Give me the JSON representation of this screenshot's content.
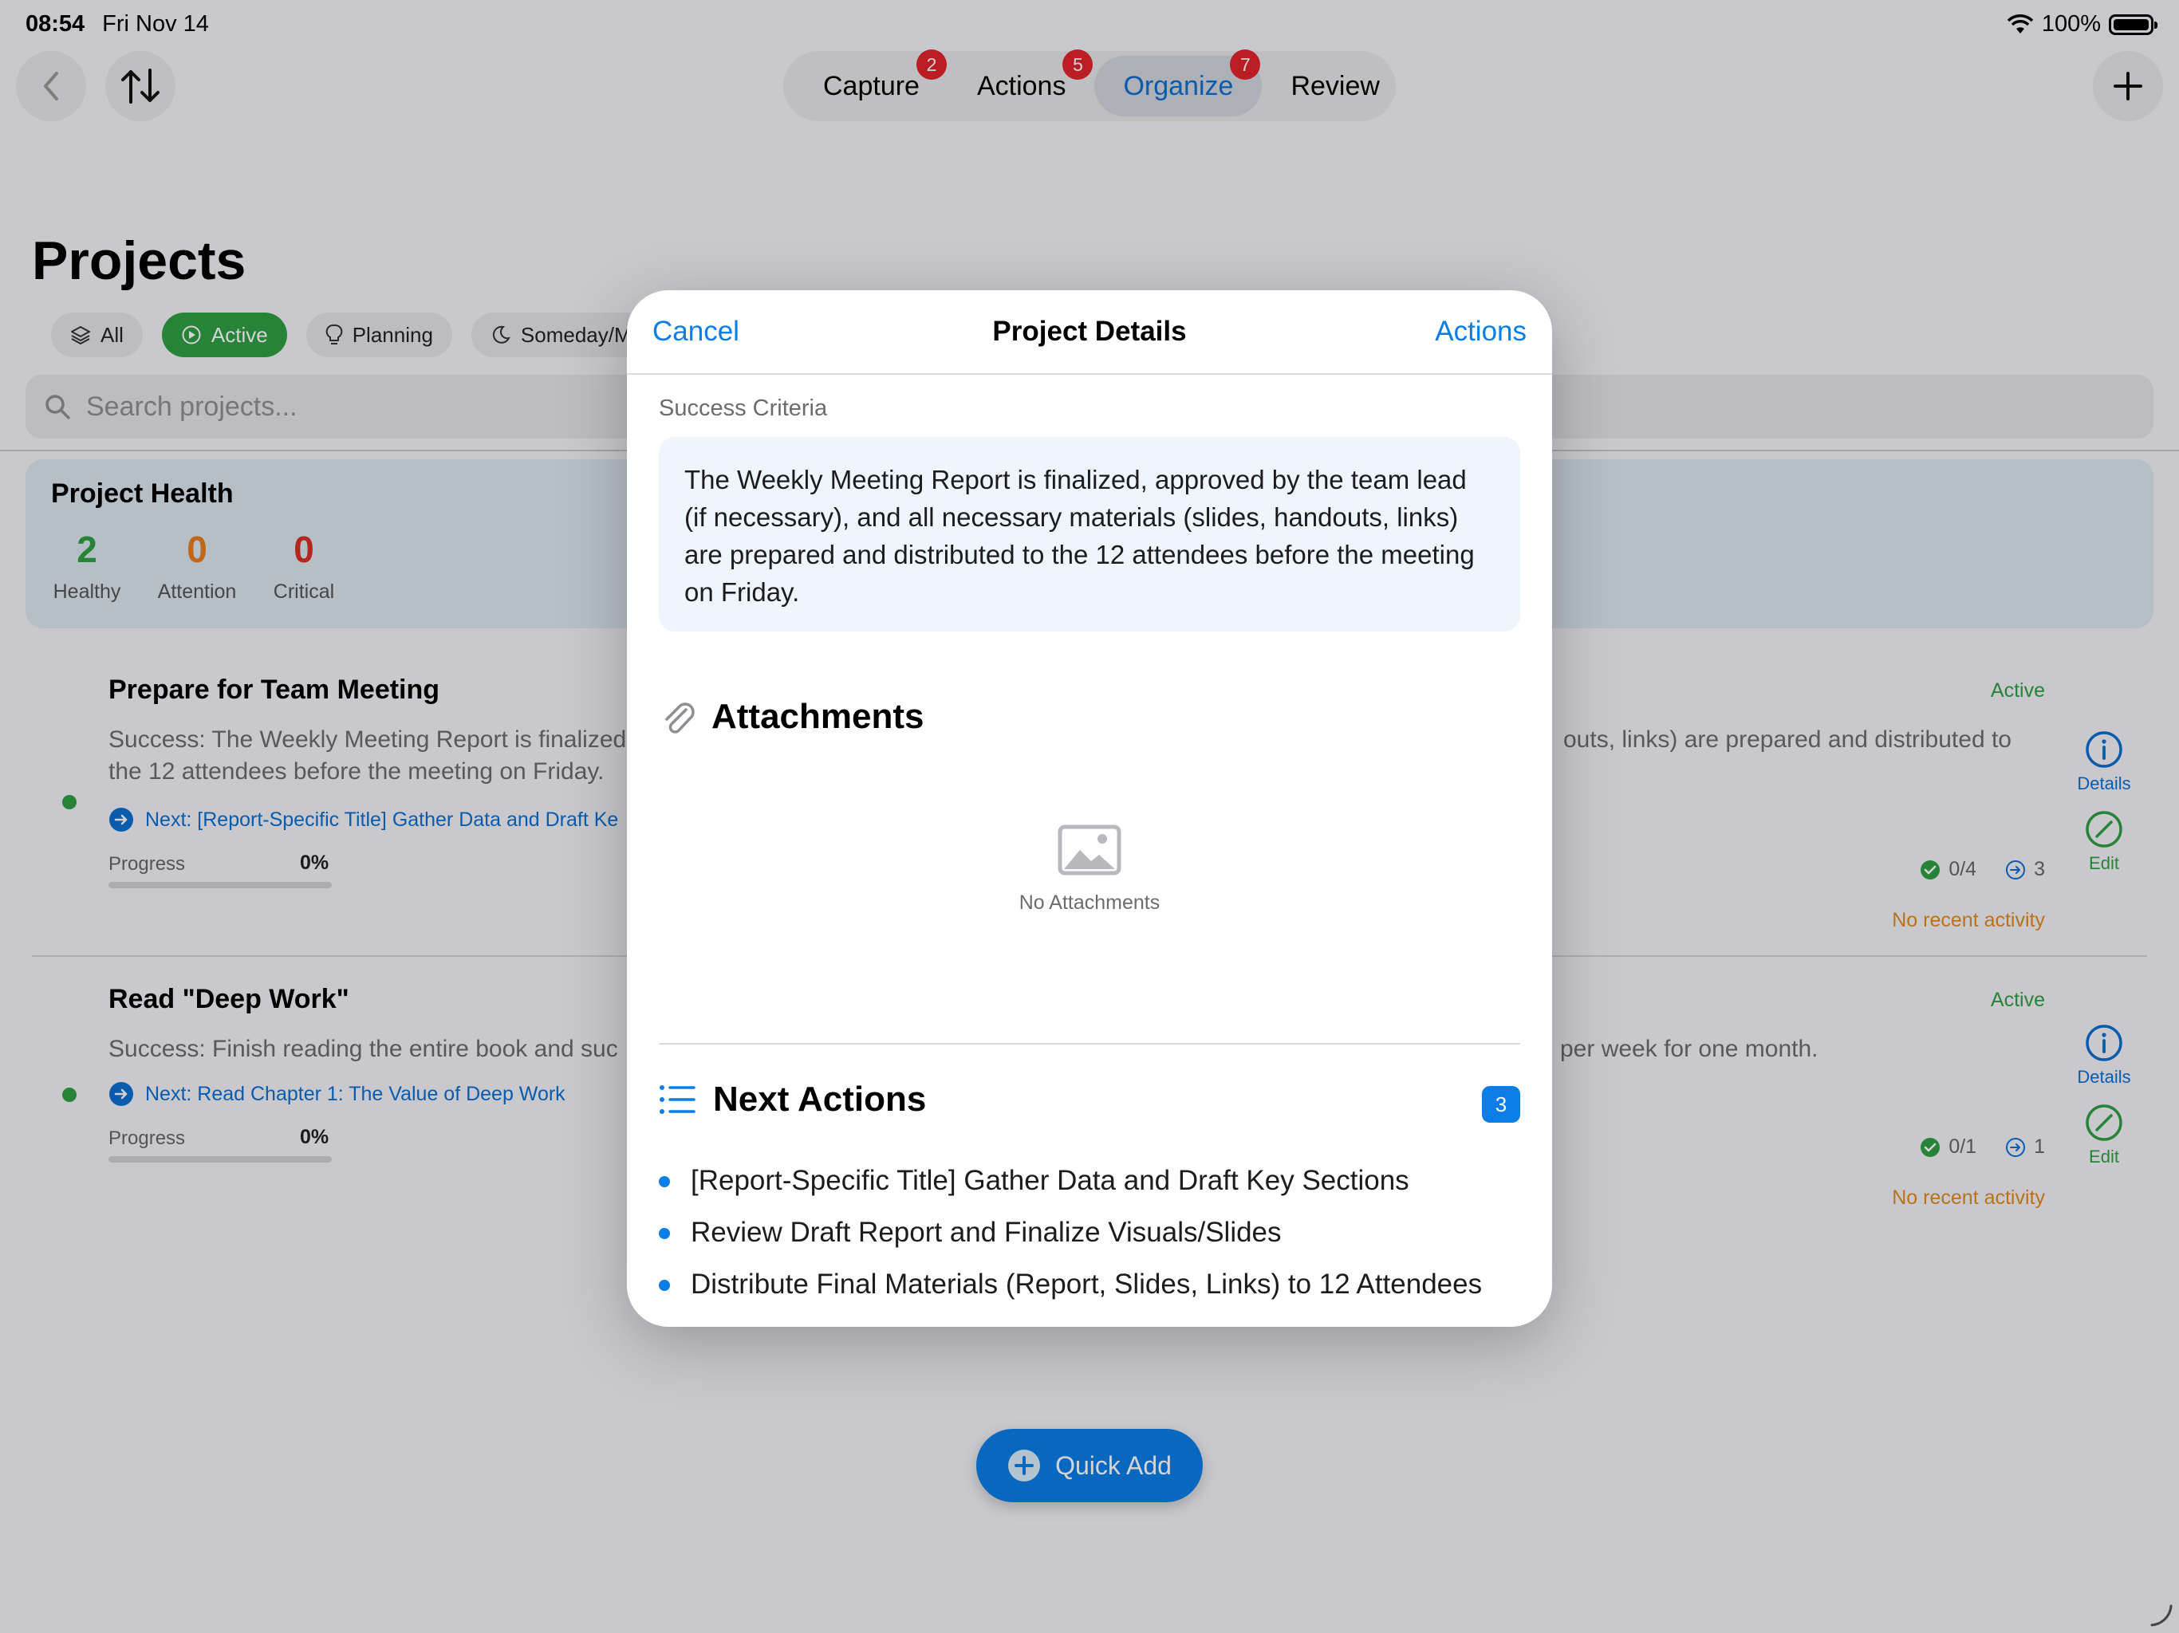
{
  "status_bar": {
    "time": "08:54",
    "date": "Fri Nov 14",
    "battery": "100%"
  },
  "nav": {
    "tabs": [
      {
        "label": "Capture",
        "badge": "2"
      },
      {
        "label": "Actions",
        "badge": "5"
      },
      {
        "label": "Organize",
        "badge": "7",
        "selected": true
      },
      {
        "label": "Review"
      }
    ]
  },
  "page": {
    "title": "Projects",
    "filters": [
      "All",
      "Active",
      "Planning",
      "Someday/M"
    ],
    "search_placeholder": "Search projects..."
  },
  "health": {
    "title": "Project Health",
    "stats": [
      {
        "value": "2",
        "label": "Healthy",
        "color": "#2f9e44"
      },
      {
        "value": "0",
        "label": "Attention",
        "color": "#e67e22"
      },
      {
        "value": "0",
        "label": "Critical",
        "color": "#d93025"
      }
    ]
  },
  "projects": [
    {
      "title": "Prepare for Team Meeting",
      "success_left": "Success: The Weekly Meeting Report is finalized",
      "success_left_2": "the 12 attendees before the meeting on Friday.",
      "success_right": "outs, links) are prepared and distributed to",
      "next": "Next: [Report-Specific Title] Gather Data and Draft Ke",
      "progress_label": "Progress",
      "progress": "0%",
      "progress_fraction": 0,
      "status": "Active",
      "done": "0/4",
      "next_count": "3",
      "recent": "No recent activity",
      "details": "Details",
      "edit": "Edit"
    },
    {
      "title": "Read \"Deep Work\"",
      "success_left": "Success: Finish reading the entire book and suc",
      "success_right": "per week for one month.",
      "next": "Next: Read Chapter 1: The Value of Deep Work",
      "progress_label": "Progress",
      "progress": "0%",
      "progress_fraction": 0,
      "status": "Active",
      "done": "0/1",
      "next_count": "1",
      "recent": "No recent activity",
      "details": "Details",
      "edit": "Edit"
    }
  ],
  "quick_add": "Quick Add",
  "modal": {
    "cancel": "Cancel",
    "title": "Project Details",
    "actions": "Actions",
    "success_label": "Success Criteria",
    "success_text": "The Weekly Meeting Report is finalized, approved by the team lead (if necessary), and all necessary materials (slides, handouts, links) are prepared and distributed to the 12 attendees before the meeting on Friday.",
    "attachments_title": "Attachments",
    "no_attachments": "No Attachments",
    "next_actions_title": "Next Actions",
    "next_actions_count": "3",
    "next_actions": [
      "[Report-Specific Title] Gather Data and Draft Key Sections",
      "Review Draft Report and Finalize Visuals/Slides",
      "Distribute Final Materials (Report, Slides, Links) to 12 Attendees"
    ]
  },
  "colors": {
    "accent": "#0a7ee6",
    "active_green": "#2f9e44",
    "badge_red": "#e0242c"
  }
}
